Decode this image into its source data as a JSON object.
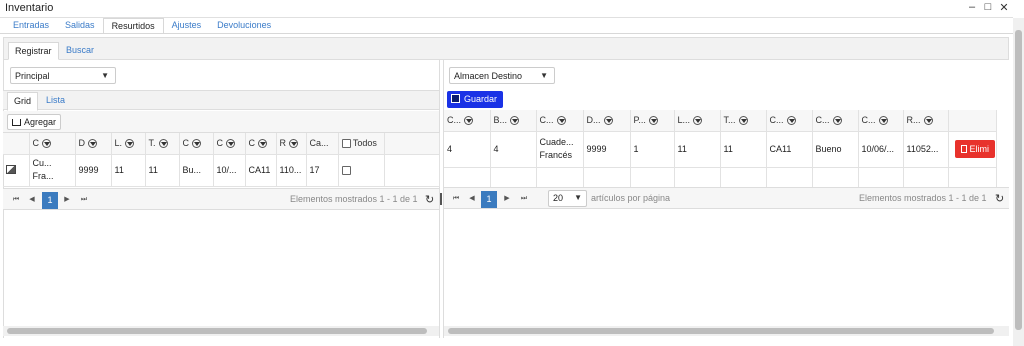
{
  "window": {
    "title": "Inventario",
    "controls": {
      "minimize": "–",
      "maximize": "□",
      "close": "✕"
    }
  },
  "main_tabs": [
    {
      "label": "Entradas",
      "active": false
    },
    {
      "label": "Salidas",
      "active": false
    },
    {
      "label": "Resurtidos",
      "active": true
    },
    {
      "label": "Ajustes",
      "active": false
    },
    {
      "label": "Devoluciones",
      "active": false
    }
  ],
  "sub_tabs": [
    {
      "label": "Registrar",
      "active": true
    },
    {
      "label": "Buscar",
      "active": false
    }
  ],
  "left": {
    "warehouse_select": "Principal",
    "view_tabs": [
      {
        "label": "Grid",
        "active": true
      },
      {
        "label": "Lista",
        "active": false
      }
    ],
    "add_button": "Agregar",
    "columns": [
      "C",
      "D",
      "L.",
      "T.",
      "C",
      "C",
      "C",
      "R",
      "Ca...",
      "Todos"
    ],
    "row": [
      "Cu... Fra...",
      "9999",
      "11",
      "11",
      "Bu...",
      "10/...",
      "CA11",
      "110...",
      "17"
    ],
    "pager": {
      "current": "1",
      "info": "Elementos mostrados 1 - 1 de 1"
    }
  },
  "right": {
    "dest_select": "Almacen Destino",
    "save_button": "Guardar",
    "columns": [
      "C...",
      "B...",
      "C...",
      "D...",
      "P...",
      "L...",
      "T...",
      "C...",
      "C...",
      "C...",
      "R..."
    ],
    "row": [
      "4",
      "4",
      "Cuade... Francés",
      "9999",
      "1",
      "11",
      "11",
      "CA11",
      "Bueno",
      "10/06/...",
      "11052..."
    ],
    "delete_button": "Elimi",
    "pager": {
      "current": "1",
      "page_size": "20",
      "page_size_label": "artículos por página",
      "info": "Elementos mostrados 1 - 1 de 1"
    }
  },
  "icons": {
    "arrow": "▼",
    "first": "⏮",
    "prev": "◀",
    "next": "▶",
    "last": "⏭",
    "refresh": "↻"
  }
}
